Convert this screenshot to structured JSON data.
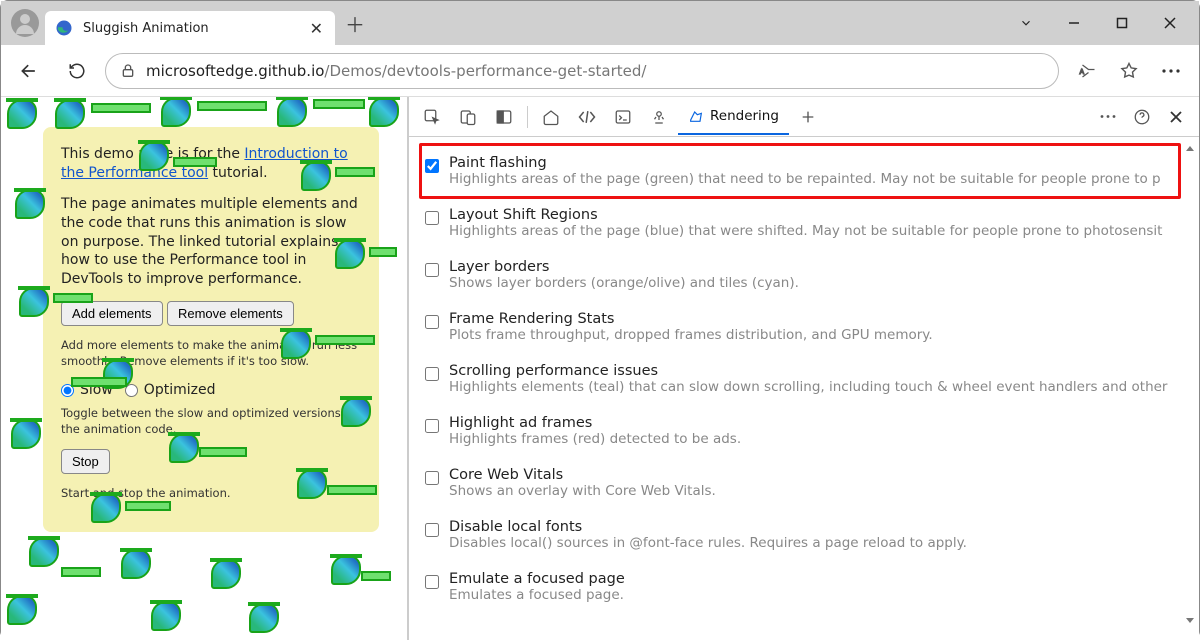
{
  "window": {
    "tab_title": "Sluggish Animation"
  },
  "toolbar": {
    "url_host": "microsoftedge.github.io",
    "url_path": "/Demos/devtools-performance-get-started/"
  },
  "page": {
    "intro_before": "This demo page is for the ",
    "intro_link": "Introduction to the Performance tool",
    "intro_after": " tutorial.",
    "body_text": "The page animates multiple elements and the code that runs this animation is slow on purpose. The linked tutorial explains how to use the Performance tool in DevTools to improve performance.",
    "add_btn": "Add elements",
    "remove_btn": "Remove elements",
    "add_help": "Add more elements to make the animation run less smoothly. Remove elements if it's too slow.",
    "radio_slow": "Slow",
    "radio_opt": "Optimized",
    "toggle_help": "Toggle between the slow and optimized versions of the animation code.",
    "stop_btn": "Stop",
    "stop_help": "Start and stop the animation."
  },
  "devtools": {
    "tab_label": "Rendering",
    "options": [
      {
        "id": "paint",
        "checked": true,
        "title": "Paint flashing",
        "desc": "Highlights areas of the page (green) that need to be repainted. May not be suitable for people prone to p"
      },
      {
        "id": "layout",
        "checked": false,
        "title": "Layout Shift Regions",
        "desc": "Highlights areas of the page (blue) that were shifted. May not be suitable for people prone to photosensit"
      },
      {
        "id": "layers",
        "checked": false,
        "title": "Layer borders",
        "desc": "Shows layer borders (orange/olive) and tiles (cyan)."
      },
      {
        "id": "frs",
        "checked": false,
        "title": "Frame Rendering Stats",
        "desc": "Plots frame throughput, dropped frames distribution, and GPU memory."
      },
      {
        "id": "scroll",
        "checked": false,
        "title": "Scrolling performance issues",
        "desc": "Highlights elements (teal) that can slow down scrolling, including touch & wheel event handlers and other"
      },
      {
        "id": "ads",
        "checked": false,
        "title": "Highlight ad frames",
        "desc": "Highlights frames (red) detected to be ads."
      },
      {
        "id": "cwv",
        "checked": false,
        "title": "Core Web Vitals",
        "desc": "Shows an overlay with Core Web Vitals."
      },
      {
        "id": "fonts",
        "checked": false,
        "title": "Disable local fonts",
        "desc": "Disables local() sources in @font-face rules. Requires a page reload to apply."
      },
      {
        "id": "focus",
        "checked": false,
        "title": "Emulate a focused page",
        "desc": "Emulates a focused page."
      }
    ]
  }
}
